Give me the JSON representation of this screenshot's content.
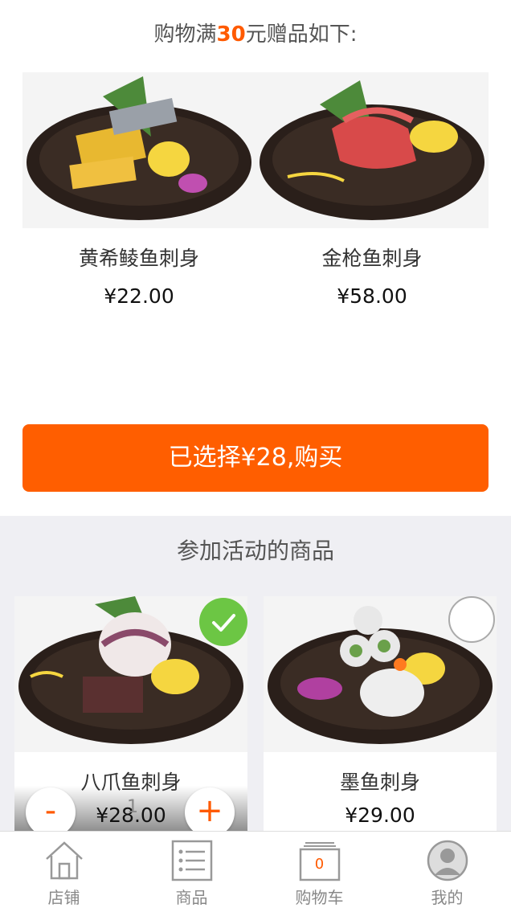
{
  "promo_title": {
    "prefix": "购物满",
    "amount": "30",
    "suffix": "元赠品如下:"
  },
  "gifts": [
    {
      "name": "黄希鲮鱼刺身",
      "price": "¥22.00"
    },
    {
      "name": "金枪鱼刺身",
      "price": "¥58.00"
    }
  ],
  "buy_button": {
    "label": "已选择¥28,购买"
  },
  "section_title": "参加活动的商品",
  "products": [
    {
      "name": "八爪鱼刺身",
      "price": "¥28.00",
      "quantity": "1",
      "selected": true,
      "minus": "-",
      "plus": "+"
    },
    {
      "name": "墨鱼刺身",
      "price": "¥29.00",
      "selected": false
    }
  ],
  "tabbar": {
    "items": [
      {
        "label": "店铺",
        "icon": "store-icon"
      },
      {
        "label": "商品",
        "icon": "list-icon"
      },
      {
        "label": "购物车",
        "icon": "cart-icon",
        "badge": "0"
      },
      {
        "label": "我的",
        "icon": "user-icon"
      }
    ]
  },
  "colors": {
    "accent": "#ff5e00",
    "check": "#6cc644",
    "section_bg": "#efeff3"
  }
}
